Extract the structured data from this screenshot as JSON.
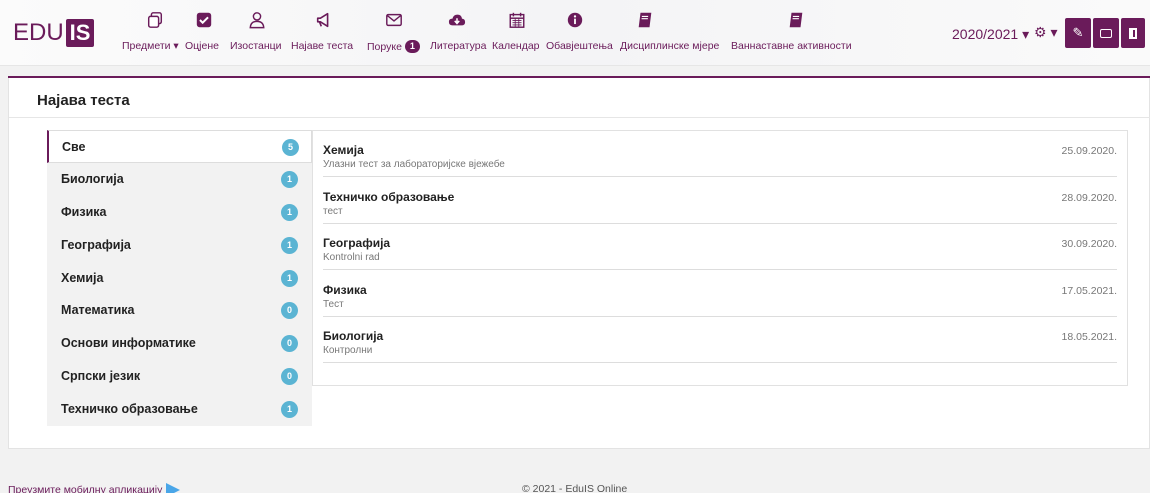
{
  "brand": {
    "edu": "EDU",
    "is": "IS"
  },
  "nav": [
    {
      "label": "Предмети ▾",
      "icon": "copy-icon"
    },
    {
      "label": "Оцјене",
      "icon": "check-square-icon"
    },
    {
      "label": "Изостанци",
      "icon": "user-icon"
    },
    {
      "label": "Најаве теста",
      "icon": "megaphone-icon"
    },
    {
      "label": "Поруке",
      "icon": "envelope-icon",
      "badge": "1"
    },
    {
      "label": "Литература",
      "icon": "cloud-download-icon"
    },
    {
      "label": "Календар",
      "icon": "calendar-icon"
    },
    {
      "label": "Обавјештења",
      "icon": "info-icon"
    },
    {
      "label": "Дисциплинске мјере",
      "icon": "book-icon"
    },
    {
      "label": "Ваннаставне активности",
      "icon": "book-icon"
    }
  ],
  "topright": {
    "year": "2020/2021 ▾",
    "gear": "⚙ ▾"
  },
  "page": {
    "title": "Најава теста"
  },
  "subjects": [
    {
      "label": "Све",
      "count": "5"
    },
    {
      "label": "Биологија",
      "count": "1"
    },
    {
      "label": "Физика",
      "count": "1"
    },
    {
      "label": "Географија",
      "count": "1"
    },
    {
      "label": "Хемија",
      "count": "1"
    },
    {
      "label": "Математика",
      "count": "0"
    },
    {
      "label": "Основи информатике",
      "count": "0"
    },
    {
      "label": "Српски језик",
      "count": "0"
    },
    {
      "label": "Техничко образовање",
      "count": "1"
    }
  ],
  "tests": [
    {
      "subject": "Хемија",
      "description": "Улазни тест за лабораторијске вјежебе",
      "date": "25.09.2020."
    },
    {
      "subject": "Техничко образовање",
      "description": "тест",
      "date": "28.09.2020."
    },
    {
      "subject": "Географија",
      "description": "Kontrolni rad",
      "date": "30.09.2020."
    },
    {
      "subject": "Физика",
      "description": "Тест",
      "date": "17.05.2021."
    },
    {
      "subject": "Биологија",
      "description": "Контролни",
      "date": "18.05.2021."
    }
  ],
  "footer": {
    "app_link": "Преузмите мобилну апликацију",
    "copyright": "© 2021 - EduIS Online"
  },
  "colors": {
    "brand": "#6a1b5a",
    "badge": "#5bb4d3"
  }
}
